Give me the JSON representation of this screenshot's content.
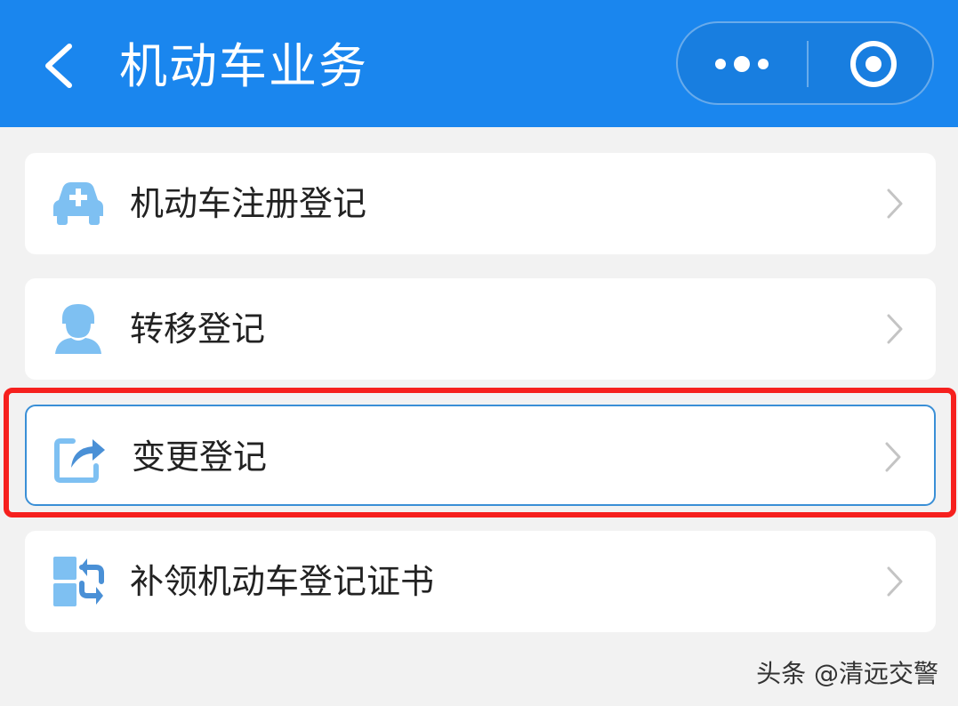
{
  "header": {
    "title": "机动车业务",
    "back_icon": "chevron-left-icon",
    "more_icon": "more-dots-icon",
    "close_icon": "target-circle-icon",
    "background_color": "#1a86ee"
  },
  "menu": {
    "items": [
      {
        "label": "机动车注册登记",
        "icon": "car-plus-icon"
      },
      {
        "label": "转移登记",
        "icon": "person-icon"
      },
      {
        "label": "变更登记",
        "icon": "share-arrow-icon",
        "highlighted": true
      },
      {
        "label": "补领机动车登记证书",
        "icon": "swap-blocks-icon"
      }
    ],
    "chevron_icon": "chevron-right-icon",
    "icon_color": "#7ec0f2",
    "highlight_color": "#f6201e"
  },
  "watermark": {
    "text": "头条 @清远交警"
  }
}
